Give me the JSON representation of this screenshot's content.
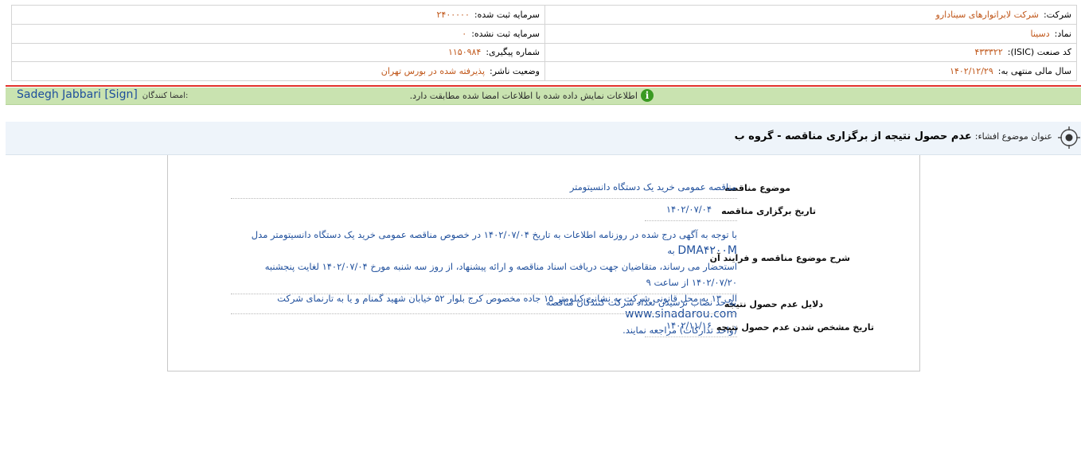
{
  "header": {
    "company_label": "شرکت:",
    "company_value": "شرکت لابراتوارهای سینادارو",
    "symbol_label": "نماد:",
    "symbol_value": "دسینا",
    "isic_label": "کد صنعت (ISIC):",
    "isic_value": "۴۳۳۳۲۲",
    "fiscal_label": "سال مالی منتهی به:",
    "fiscal_value": "۱۴۰۲/۱۲/۲۹",
    "reg_capital_label": "سرمایه ثبت شده:",
    "reg_capital_value": "۲۴۰۰۰۰۰",
    "unreg_capital_label": "سرمایه ثبت نشده:",
    "unreg_capital_value": "۰",
    "tracking_label": "شماره پیگیری:",
    "tracking_value": "۱۱۵۰۹۸۴",
    "publisher_status_label": "وضعیت ناشر:",
    "publisher_status_value": "پذیرفته شده در بورس تهران"
  },
  "verification": {
    "message": "اطلاعات نمایش داده شده با اطلاعات امضا شده مطابقت دارد.",
    "signers_label": "امضا کنندگان:",
    "signer_name": "Sadegh Jabbari [Sign]"
  },
  "disclosure": {
    "subject_label": "عنوان موضوع افشاء:",
    "subject_value": "عدم حصول نتیجه از برگزاری مناقصه - گروه ب"
  },
  "details": {
    "tender_subject_label": "موضوع مناقصه",
    "tender_subject_value": "مناقصه عمومی خرید یک دستگاه دانسیتومتر",
    "tender_date_label": "تاریخ برگزاری مناقصه",
    "tender_date_value": "۱۴۰۲/۰۷/۰۴",
    "description_label": "شرح موضوع مناقصه و فرایند آن",
    "description_line1_pre": "با توجه به آگهی درج شده در روزنامه اطلاعات به تاریخ ۱۴۰۲/۰۷/۰۴ در خصوص مناقصه عمومی خرید یک دستگاه دانسیتومتر مدل",
    "description_model": "DMA۴۲۰۰M",
    "description_line1_post": "به",
    "description_line2": "استحضار می رساند، متقاضیان جهت دریافت اسناد مناقصه و ارائه پیشنهاد، از روز سه شنبه مورخ ۱۴۰۲/۰۷/۰۴ لغایت پنجشنبه ۱۴۰۲/۰۷/۲۰ از ساعت ۹",
    "description_line3_pre": "الی ۱۳ به محل قانونی شرکت به نشانی کیلومتر ۱۵ جاده مخصوص کرج بلوار ۵۲ خیابان شهید گمنام و یا به تارنمای شرکت",
    "description_website": "www.sinadarou.com",
    "description_line4": "(واحد تدارکات) مراجعه نمایند.",
    "reasons_label": "دلایل عدم حصول نتیجه",
    "reasons_value": "به حد نصاب نرسیدن تعداد شرکت کنندگان مناقصه",
    "result_date_label": "تاریخ مشخص شدن عدم حصول نتیجه",
    "result_date_value": "۱۴۰۲/۱۱/۱۶"
  }
}
